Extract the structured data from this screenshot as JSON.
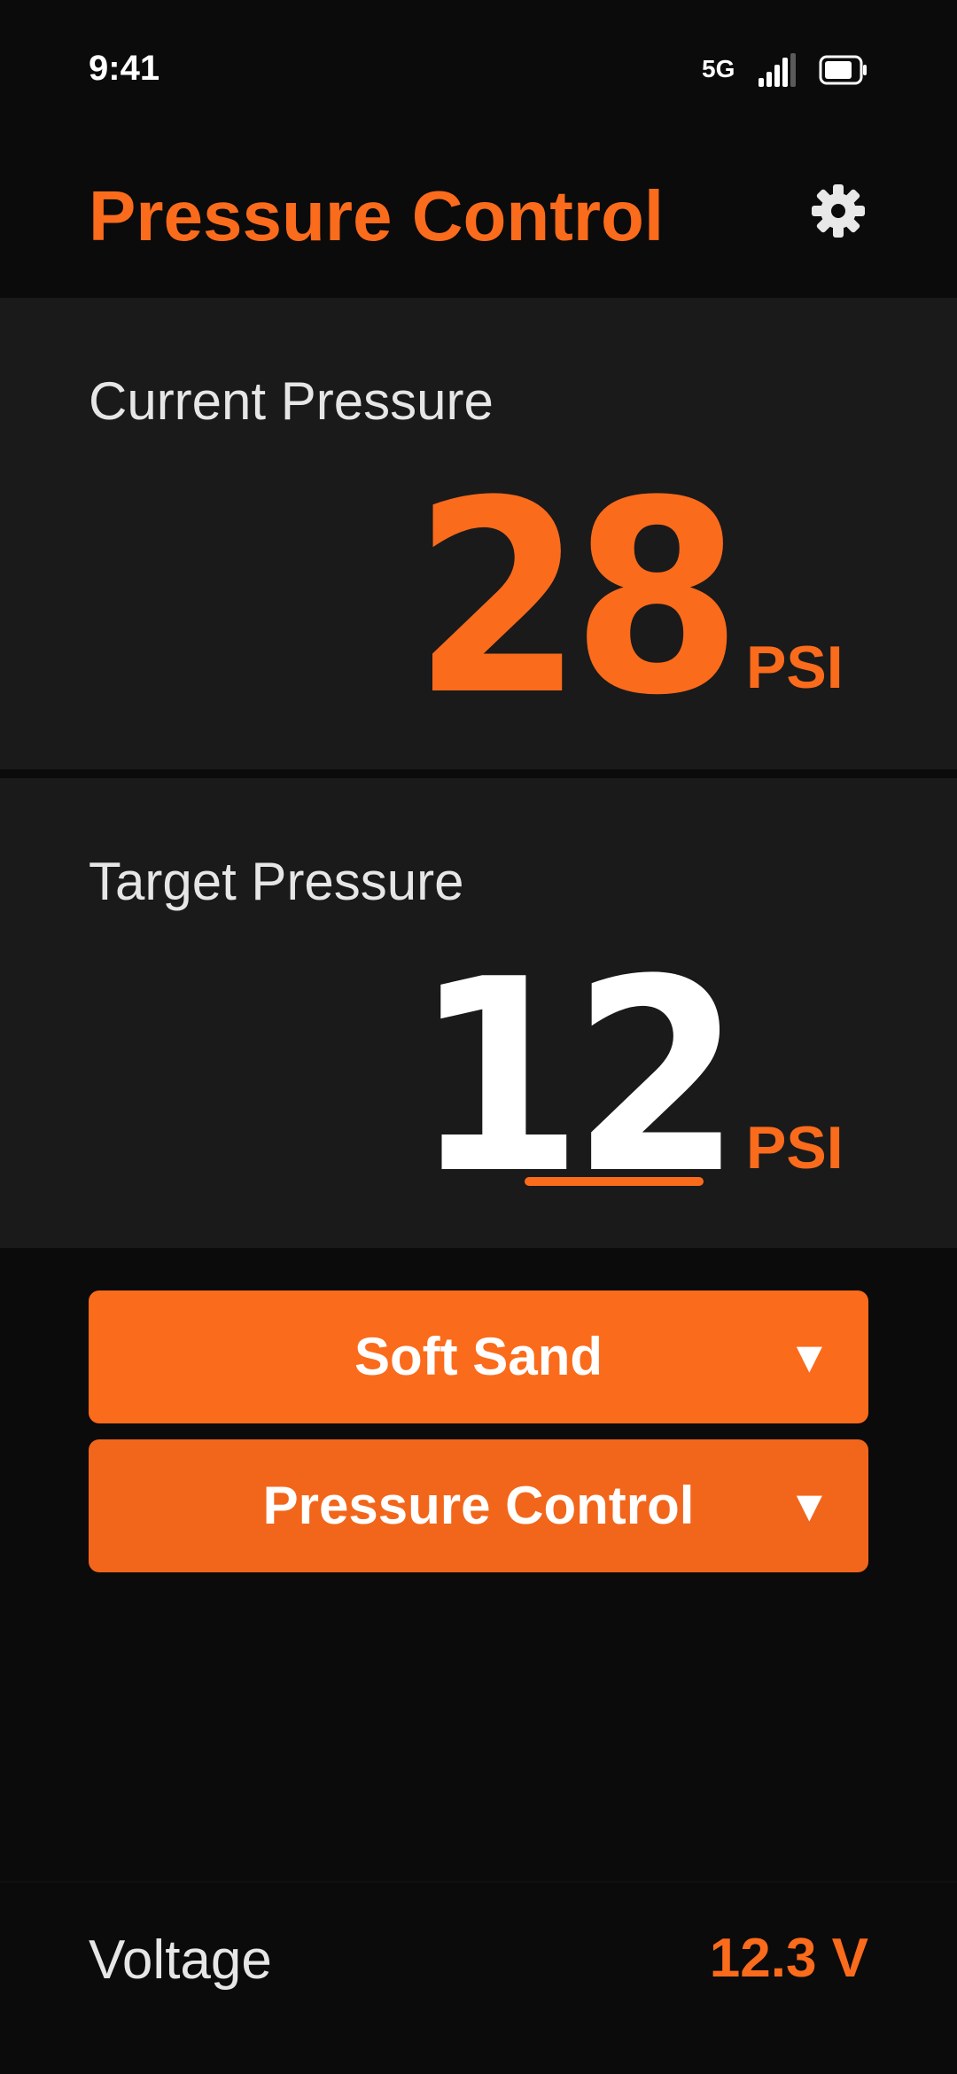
{
  "status_bar": {
    "time": "9:41",
    "network": "5G",
    "signal_icon": "signal-bars-icon",
    "battery_icon": "battery-icon"
  },
  "header": {
    "title": "Pressure Control",
    "settings_icon": "gear-icon"
  },
  "current_pressure": {
    "label": "Current Pressure",
    "value": "28",
    "unit": "PSI"
  },
  "target_pressure": {
    "label": "Target Pressure",
    "value": "12",
    "unit": "PSI"
  },
  "terrain_select": {
    "selected": "Soft Sand",
    "arrow": "▼"
  },
  "mode_select": {
    "selected": "Pressure Control",
    "arrow": "▼"
  },
  "footer": {
    "voltage_label": "Voltage",
    "voltage_value": "12.3 V"
  },
  "colors": {
    "accent": "#fb6b1c",
    "background": "#0b0b0b",
    "panel": "#1a1a1a",
    "text": "#ffffff"
  }
}
